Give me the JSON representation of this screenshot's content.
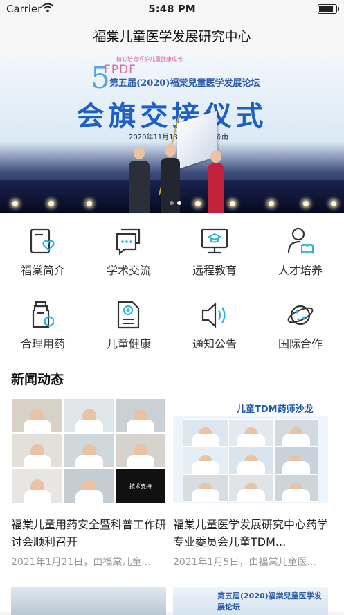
{
  "status_bar": {
    "carrier": "Carrier",
    "time": "5:48 PM",
    "battery_level": 0.92
  },
  "nav": {
    "title": "福棠儿童医学发展研究中心"
  },
  "banner": {
    "number": "5",
    "brand": "FPDF",
    "slogan": "精心培育呵护儿童健康成长",
    "forum_title": "第五届(2020)福棠兒童医学发展论坛",
    "headline": "会旗交接仪式",
    "date": "2020年11月13日 ~15日",
    "city": "济南",
    "slides": 2,
    "active_slide": 1
  },
  "menu": [
    {
      "label": "福棠简介",
      "icon": "heart-card-icon"
    },
    {
      "label": "学术交流",
      "icon": "chat-bubbles-icon"
    },
    {
      "label": "远程教育",
      "icon": "monitor-graduation-icon"
    },
    {
      "label": "人才培养",
      "icon": "person-book-icon"
    },
    {
      "label": "合理用药",
      "icon": "medicine-bottle-icon"
    },
    {
      "label": "儿童健康",
      "icon": "health-document-icon"
    },
    {
      "label": "通知公告",
      "icon": "speaker-icon"
    },
    {
      "label": "国际合作",
      "icon": "globe-orbit-icon"
    }
  ],
  "news": {
    "section_title": "新闻动态",
    "items": [
      {
        "title": "福棠儿童用药安全暨科普工作研讨会顺利召开",
        "meta": "2021年1月21日，由福棠儿童..."
      },
      {
        "title": "福棠儿童医学发展研究中心药学专业委员会儿童TDM...",
        "meta": "2021年1月5日，由福棠儿童医..."
      }
    ],
    "second_banner": {
      "brand": "TDM",
      "banner_title": "儿童TDM药师沙龙",
      "support_text": "技术支持"
    }
  },
  "colors": {
    "accent": "#2bb6d6",
    "icon_stroke": "#333333"
  }
}
